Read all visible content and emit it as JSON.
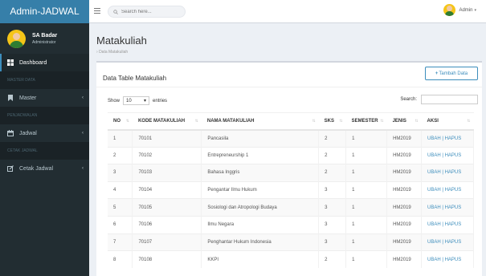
{
  "app": {
    "brand": "Admin-JADWAL"
  },
  "user": {
    "name": "SA Badar",
    "role": "Administrator",
    "top_name": "Admin"
  },
  "search": {
    "placeholder": "Search here..."
  },
  "sidebar": {
    "dashboard": "Dashboard",
    "header_master": "MASTER DATA",
    "master": "Master",
    "header_penjadwalan": "PENJADWALAN",
    "jadwal": "Jadwal",
    "header_cetak": "CETAK JADWAL",
    "cetak": "Cetak Jadwal"
  },
  "page": {
    "title": "Matakuliah",
    "breadcrumb": "Data Matakuliah",
    "box_title": "Data Table Matakuliah",
    "add_button": "Tambah Data",
    "show_label": "Show",
    "entries_value": "10",
    "entries_label": "entries",
    "search_label": "Search:"
  },
  "table": {
    "headers": [
      "NO",
      "KODE MATAKULIAH",
      "NAMA MATAKULIAH",
      "SKS",
      "SEMESTER",
      "JENIS",
      "AKSI"
    ],
    "rows": [
      [
        "1",
        "70101",
        "Pancasila",
        "2",
        "1",
        "HM2019",
        "UBAH | HAPUS"
      ],
      [
        "2",
        "70102",
        "Entrepreneurship 1",
        "2",
        "1",
        "HM2019",
        "UBAH | HAPUS"
      ],
      [
        "3",
        "70103",
        "Bahasa Inggris",
        "2",
        "1",
        "HM2019",
        "UBAH | HAPUS"
      ],
      [
        "4",
        "70104",
        "Pengantar Ilmu Hukum",
        "3",
        "1",
        "HM2019",
        "UBAH | HAPUS"
      ],
      [
        "5",
        "70105",
        "Sosiologi dan Atropologi Budaya",
        "3",
        "1",
        "HM2019",
        "UBAH | HAPUS"
      ],
      [
        "6",
        "70106",
        "Ilmu Negara",
        "3",
        "1",
        "HM2019",
        "UBAH | HAPUS"
      ],
      [
        "7",
        "70107",
        "Penghantar Hukum Indonesia",
        "3",
        "1",
        "HM2019",
        "UBAH | HAPUS"
      ],
      [
        "8",
        "70108",
        "KKPI",
        "2",
        "1",
        "HM2019",
        "UBAH | HAPUS"
      ]
    ]
  },
  "colors": {
    "brand": "#367fa9",
    "sidebar": "#222d32",
    "accent": "#3c8dbc"
  }
}
